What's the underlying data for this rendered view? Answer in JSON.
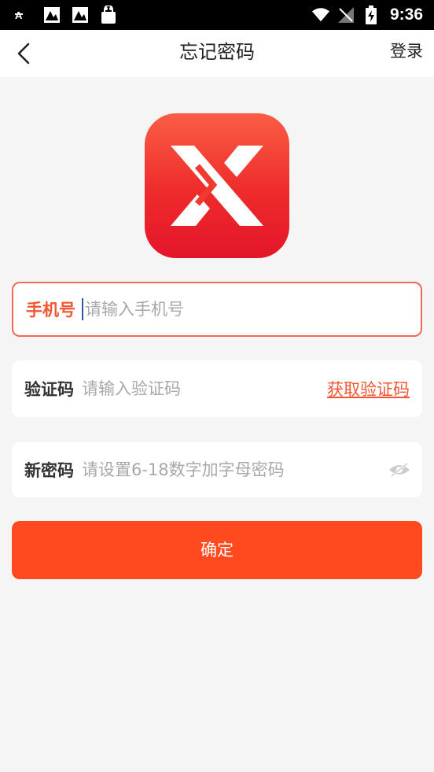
{
  "status_bar": {
    "time": "9:36",
    "icons": [
      "font-icon",
      "image-icon",
      "image-icon",
      "shopping-bag-icon",
      "wifi-icon",
      "signal-off-icon",
      "battery-charging-icon"
    ]
  },
  "app_bar": {
    "title": "忘记密码",
    "login_label": "登录"
  },
  "form": {
    "phone": {
      "label": "手机号",
      "placeholder": "请输入手机号"
    },
    "code": {
      "label": "验证码",
      "placeholder": "请输入验证码",
      "get_code_label": "获取验证码"
    },
    "password": {
      "label": "新密码",
      "placeholder": "请设置6-18数字加字母密码"
    },
    "confirm_label": "确定"
  },
  "colors": {
    "accent": "#ff4a1f",
    "logo_top": "#fa5d45",
    "logo_bottom": "#e4152a"
  }
}
